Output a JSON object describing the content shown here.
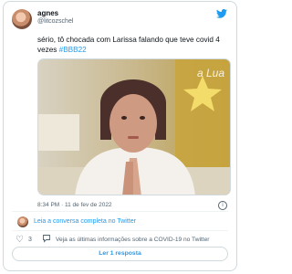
{
  "author": {
    "name": "agnes",
    "handle": "@litcozschel"
  },
  "tweet": {
    "text": "sério, tô chocada com Larissa falando que teve covid 4 vezes ",
    "hashtag": "#BBB22",
    "media_overlay_text": "a Lua",
    "timestamp": "8:34 PM · 11 de fev de 2022"
  },
  "footer": {
    "conversation_link": "Leia a conversa completa no Twitter",
    "like_count": "3",
    "covid_info_link": "Veja as últimas informações sobre a COVID-19 no Twitter",
    "replies_button": "Ler 1 resposta"
  },
  "icons": {
    "brand": "twitter-bird-icon",
    "info": "info-icon",
    "like": "heart-icon",
    "covid": "speech-bubble-icon"
  },
  "colors": {
    "accent": "#1d9bf0",
    "text": "#0f1419",
    "muted": "#536471",
    "border": "#cfd9de"
  }
}
